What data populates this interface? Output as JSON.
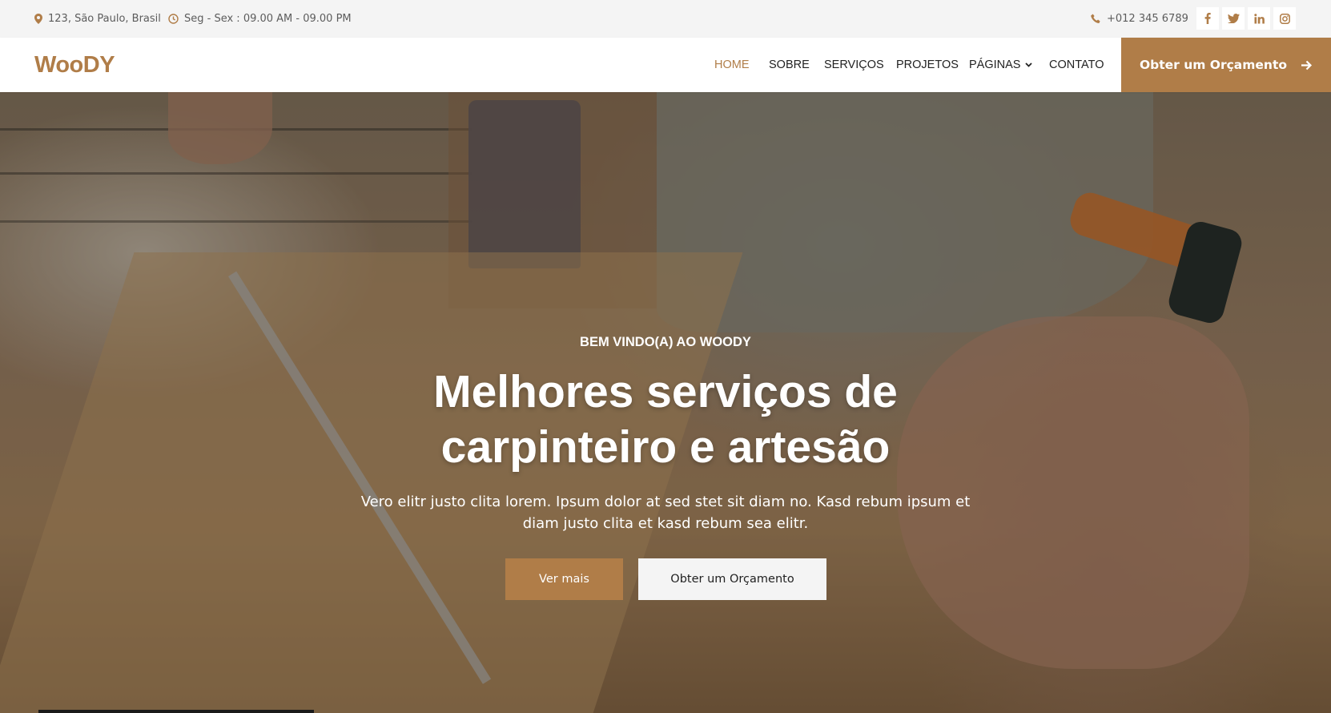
{
  "topbar": {
    "address": "123, São Paulo, Brasil",
    "hours": "Seg - Sex : 09.00 AM - 09.00 PM",
    "phone": "+012 345 6789",
    "social": [
      "facebook-icon",
      "twitter-icon",
      "linkedin-icon",
      "instagram-icon"
    ]
  },
  "nav": {
    "logo": "WooDY",
    "links": [
      "HOME",
      "SOBRE",
      "SERVIÇOS",
      "PROJETOS",
      "PÁGINAS",
      "CONTATO"
    ],
    "active": "HOME",
    "cta": "Obter um Orçamento"
  },
  "hero": {
    "subtitle": "BEM VINDO(A) AO WOODY",
    "title_line1": "Melhores serviços de",
    "title_line2": "carpinteiro e artesão",
    "text": "Vero elitr justo clita lorem. Ipsum dolor at sed stet sit diam no. Kasd rebum ipsum et diam justo clita et kasd rebum sea elitr.",
    "btn_primary": "Ver mais",
    "btn_secondary": "Obter um Orçamento"
  },
  "colors": {
    "accent": "#b07d48",
    "topbar_bg": "#f4f4f4",
    "text_dark": "#222222"
  }
}
